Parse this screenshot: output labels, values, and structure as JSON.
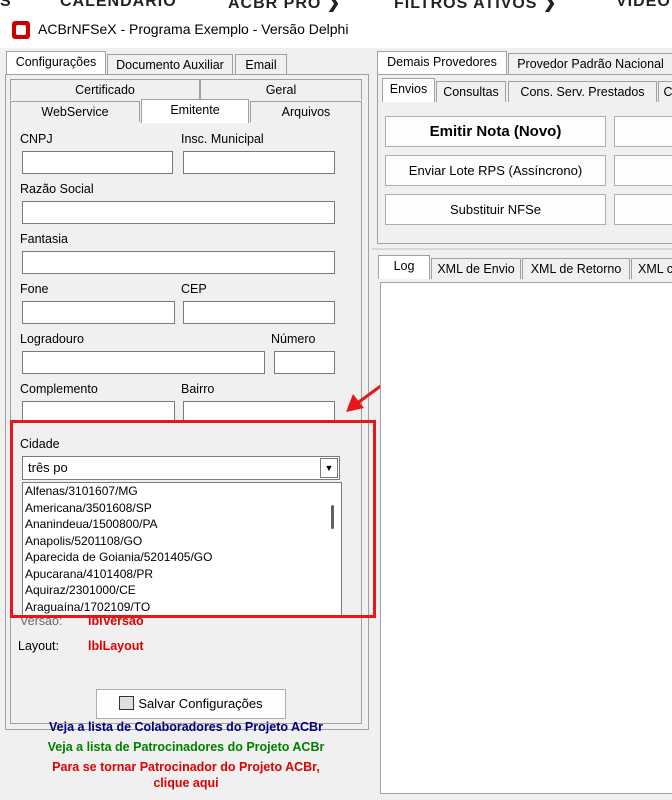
{
  "topbar": {
    "items": [
      "S",
      "CALENDÁRIO",
      "ACBR PRO ❯",
      "FILTROS ATIVOS ❯",
      "VÍDEO"
    ]
  },
  "window": {
    "title": "ACBrNFSeX - Programa Exemplo - Versão Delphi"
  },
  "left_tabs": {
    "top": [
      "Configurações",
      "Documento Auxiliar",
      "Email"
    ]
  },
  "config_tabs": {
    "row1": [
      "Certificado",
      "Geral"
    ],
    "row2": [
      "WebService",
      "Emitente",
      "Arquivos"
    ]
  },
  "form": {
    "cnpj": "CNPJ",
    "insc_municipal": "Insc. Municipal",
    "razao_social": "Razão Social",
    "fantasia": "Fantasia",
    "fone": "Fone",
    "cep": "CEP",
    "logradouro": "Logradouro",
    "numero": "Número",
    "complemento": "Complemento",
    "bairro": "Bairro",
    "cidade": "Cidade",
    "versao_label": "Versão:",
    "versao_value": "lblVersao",
    "layout_label": "Layout:",
    "layout_value": "lblLayout"
  },
  "city_search": {
    "value": "três po"
  },
  "city_list": [
    "Alfenas/3101607/MG",
    "Americana/3501608/SP",
    "Ananindeua/1500800/PA",
    "Anapolis/5201108/GO",
    "Aparecida de Goiania/5201405/GO",
    "Apucarana/4101408/PR",
    "Aquiraz/2301000/CE",
    "Araguaína/1702109/TO"
  ],
  "save_button": {
    "label": "Salvar Configurações"
  },
  "credits": {
    "colab": "Veja a lista de Colaboradores do Projeto ACBr",
    "patroc": "Veja a lista de Patrocinadores do Projeto ACBr",
    "become1": "Para se tornar Patrocinador do Projeto ACBr,",
    "become2": "clique aqui"
  },
  "right_tabs": {
    "providers": [
      "Demais Provedores",
      "Provedor Padrão Nacional"
    ],
    "sub": [
      "Envios",
      "Consultas",
      "Cons. Serv. Prestados",
      "C"
    ]
  },
  "actions": {
    "emitir": "Emitir Nota (Novo)",
    "enviar_lote": "Enviar Lote RPS (Assíncrono)",
    "substituir": "Substituir NFSe"
  },
  "log_tabs": [
    "Log",
    "XML de Envio",
    "XML de Retorno",
    "XML c"
  ],
  "colors": {
    "highlight": "#e8151d",
    "credit_blue": "#00007f",
    "credit_green": "#007f00",
    "credit_red": "#e00000"
  }
}
